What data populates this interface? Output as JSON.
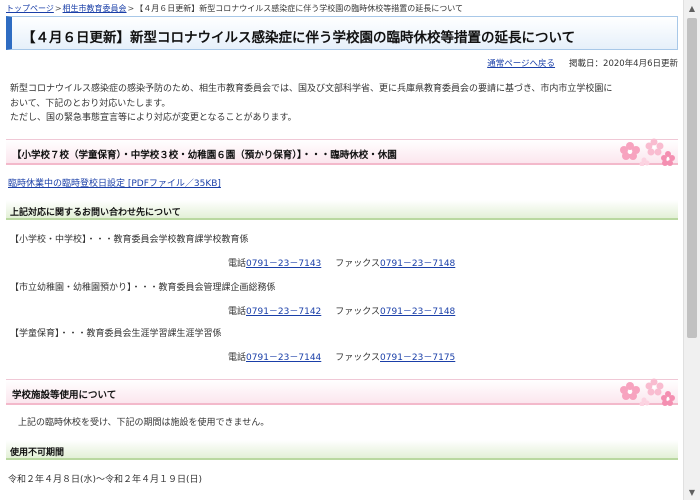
{
  "breadcrumb": {
    "home": "トップページ",
    "sep1": ">",
    "board": "相生市教育委員会",
    "sep2": ">",
    "current": "【４月６日更新】新型コロナウイルス感染症に伴う学校園の臨時休校等措置の延長について"
  },
  "page_title": "【４月６日更新】新型コロナウイルス感染症に伴う学校園の臨時休校等措置の延長について",
  "top_links": {
    "normal_page": "通常ページへ戻る",
    "published": "掲載日：2020年4月6日更新"
  },
  "intro": {
    "line1": "新型コロナウイルス感染症の感染予防のため、相生市教育委員会では、国及び文部科学省、更に兵庫県教育委員会の要請に基づき、市内市立学校園に",
    "line2": "おいて、下記のとおり対応いたします。",
    "line3": "ただし、国の緊急事態宣言等により対応が変更となることがあります。"
  },
  "section_closure": {
    "header": "【小学校７校（学童保育）・中学校３校・幼稚園６園（預かり保育）】・・・臨時休校・休園",
    "pdf_link": "臨時休業中の臨時登校日設定 [PDFファイル／35KB]"
  },
  "section_contact": {
    "header": "上記対応に関するお問い合わせ先について",
    "entries": [
      {
        "label": "【小学校・中学校】・・・教育委員会学校教育課学校教育係",
        "tel_prefix": "電話",
        "tel": "0791－23－7143",
        "fax_prefix": "ファックス",
        "fax": "0791－23－7148"
      },
      {
        "label": "【市立幼稚園・幼稚園預かり】・・・教育委員会管理課企画総務係",
        "tel_prefix": "電話",
        "tel": "0791－23－7142",
        "fax_prefix": "ファックス",
        "fax": "0791－23－7148"
      },
      {
        "label": "【学童保育】・・・教育委員会生涯学習課生涯学習係",
        "tel_prefix": "電話",
        "tel": "0791－23－7144",
        "fax_prefix": "ファックス",
        "fax": "0791－23－7175"
      }
    ]
  },
  "section_facility": {
    "header": "学校施設等使用について",
    "text": "上記の臨時休校を受け、下記の期間は施設を使用できません。"
  },
  "section_period": {
    "header": "使用不可期間",
    "text": "令和２年４月８日(水)～令和２年４月１９日(日)"
  },
  "colors": {
    "link": "#1a3fa8",
    "title_accent": "#2e6cc2",
    "pink_header": "#fbe6ee",
    "green_header": "#e3f0d7"
  }
}
